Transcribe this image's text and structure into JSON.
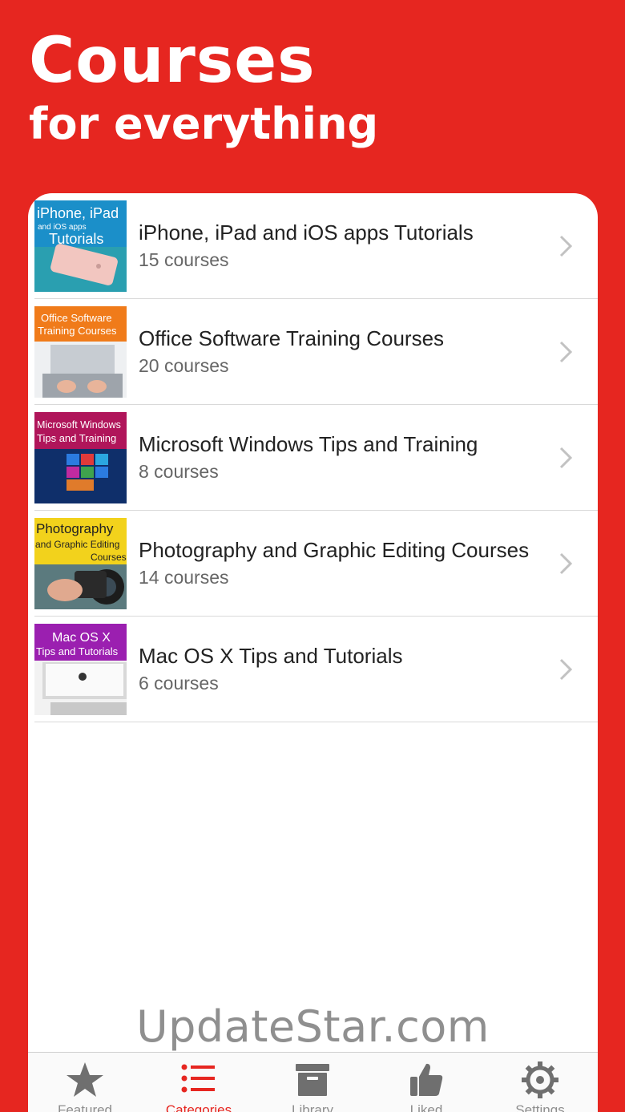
{
  "hero": {
    "title": "Courses",
    "subtitle": "for everything"
  },
  "categories": [
    {
      "title": "iPhone, iPad and iOS apps Tutorials",
      "count": "15 courses",
      "thumb": {
        "lines": [
          "iPhone, iPad",
          "and iOS apps",
          "Tutorials"
        ],
        "bg": "#1b8fc9"
      }
    },
    {
      "title": "Office Software Training Courses",
      "count": "20 courses",
      "thumb": {
        "lines": [
          "Office Software",
          "Training Courses"
        ],
        "bg": "#f07b1a"
      }
    },
    {
      "title": "Microsoft Windows Tips and Training",
      "count": "8 courses",
      "thumb": {
        "lines": [
          "Microsoft Windows",
          "Tips and Training"
        ],
        "bg": "#b0155a"
      }
    },
    {
      "title": "Photography and Graphic Editing Courses",
      "count": "14 courses",
      "thumb": {
        "lines": [
          "Photography",
          "and Graphic Editing",
          "Courses"
        ],
        "bg": "#f2d21c"
      }
    },
    {
      "title": "Mac OS X Tips and Tutorials",
      "count": "6 courses",
      "thumb": {
        "lines": [
          "Mac OS X",
          "Tips and Tutorials"
        ],
        "bg": "#9b1fb0"
      }
    }
  ],
  "watermark": "UpdateStar.com",
  "tabs": [
    {
      "label": "Featured",
      "icon": "star-icon",
      "active": false
    },
    {
      "label": "Categories",
      "icon": "list-icon",
      "active": true
    },
    {
      "label": "Library",
      "icon": "archive-box-icon",
      "active": false
    },
    {
      "label": "Liked",
      "icon": "thumbs-up-icon",
      "active": false
    },
    {
      "label": "Settings",
      "icon": "gear-icon",
      "active": false
    }
  ],
  "colors": {
    "brand": "#e62620",
    "tab_inactive": "#8e8e8e"
  }
}
